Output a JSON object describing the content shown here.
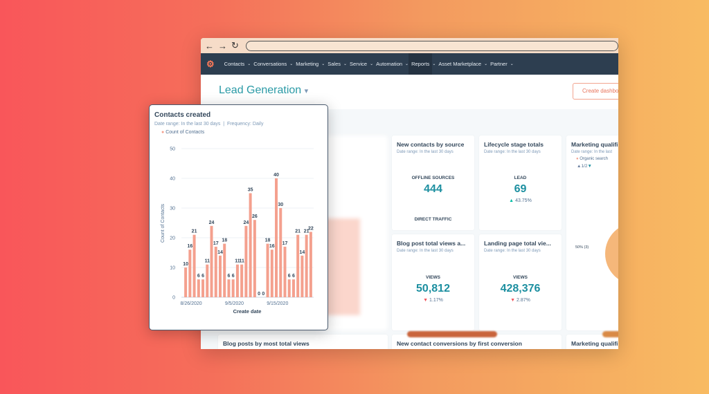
{
  "browser": {
    "back": "←",
    "forward": "→",
    "reload": "↻"
  },
  "nav": {
    "items": [
      "Contacts",
      "Conversations",
      "Marketing",
      "Sales",
      "Service",
      "Automation",
      "Reports",
      "Asset Marketplace",
      "Partner"
    ],
    "active": "Reports",
    "chev": "⌄"
  },
  "header": {
    "title": "Lead Generation",
    "caret": "▾",
    "create_button": "Create dashboard"
  },
  "cards": {
    "new_contacts": {
      "title": "New contacts by source",
      "sub": "Date range: In the last 30 days",
      "label": "OFFLINE SOURCES",
      "value": "444",
      "label2": "DIRECT TRAFFIC"
    },
    "lifecycle": {
      "title": "Lifecycle stage totals",
      "sub": "Date range: In the last 30 days",
      "label": "LEAD",
      "value": "69",
      "change": "43.75%",
      "dir": "up"
    },
    "mql": {
      "title": "Marketing qualifi",
      "sub": "Date range: In the last",
      "legend": "Organic search",
      "pager": "1/2",
      "slice_label": "50% (3)"
    },
    "blog": {
      "title": "Blog post total views a...",
      "sub": "Date range: In the last 30 days",
      "label": "VIEWS",
      "value": "50,812",
      "change": "1.17%",
      "dir": "down"
    },
    "landing": {
      "title": "Landing page total vie...",
      "sub": "Date range: In the last 30 days",
      "label": "VIEWS",
      "value": "428,376",
      "change": "2.87%",
      "dir": "down"
    },
    "bottom": [
      "Blog posts by most total views",
      "New contact conversions by first conversion",
      "Marketing qualifi"
    ]
  },
  "colors": {
    "accent": "#1c8fa0",
    "bar": "#f4a08e",
    "nav": "#2d3e50",
    "up": "#00bda5",
    "down": "#f2545b"
  },
  "chart_data": {
    "type": "bar",
    "title": "Contacts created",
    "subtitle": "Date range: In the last 30 days",
    "frequency": "Frequency: Daily",
    "legend": "Count of Contacts",
    "xlabel": "Create date",
    "ylabel": "Count of Contacts",
    "ylim": [
      0,
      50
    ],
    "yticks": [
      "0",
      "10",
      "20",
      "30",
      "40",
      "50"
    ],
    "xticks": [
      "8/26/2020",
      "9/5/2020",
      "9/15/2020"
    ],
    "values": [
      10,
      16,
      21,
      6,
      6,
      11,
      24,
      17,
      14,
      18,
      6,
      6,
      11,
      11,
      24,
      35,
      26,
      0,
      0,
      18,
      16,
      40,
      30,
      17,
      6,
      6,
      21,
      14,
      21,
      22
    ],
    "grid": true
  }
}
